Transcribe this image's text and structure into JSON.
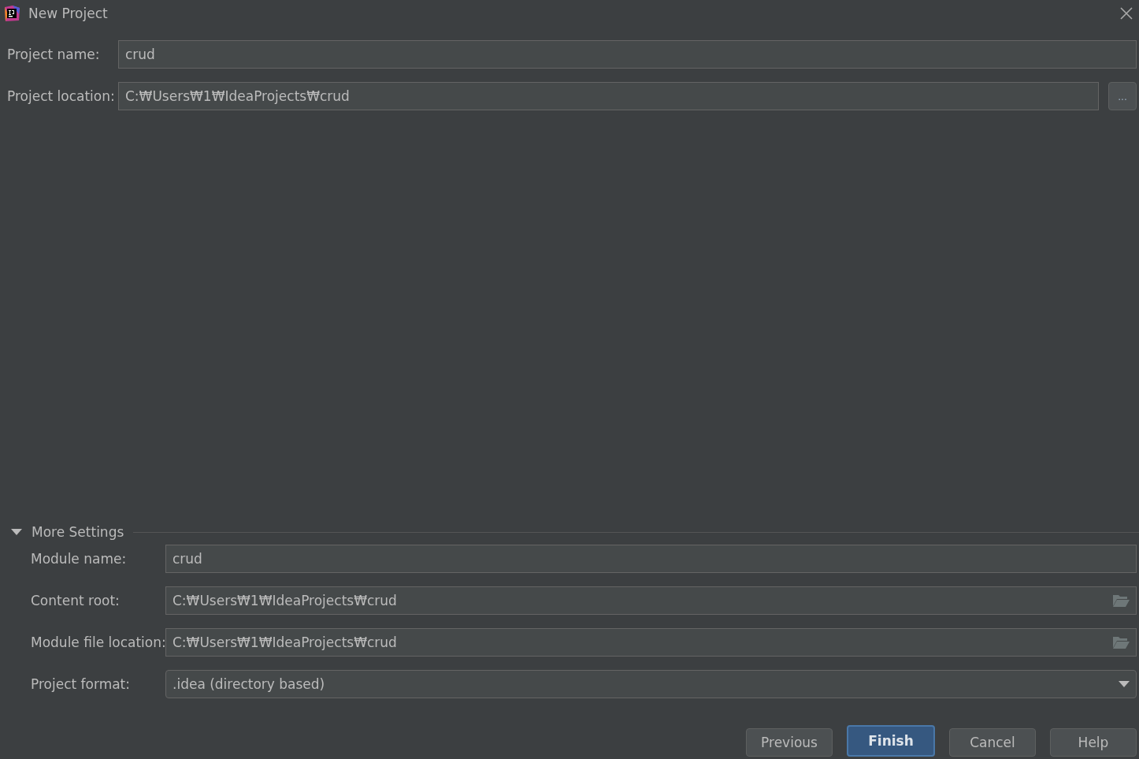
{
  "window": {
    "title": "New Project"
  },
  "top_fields": [
    {
      "label": "Project name:",
      "value": "crud",
      "kind": "text"
    },
    {
      "label": "Project location:",
      "value": "C:₩Users₩1₩IdeaProjects₩crud",
      "kind": "browse",
      "browse_label": "..."
    }
  ],
  "more_settings": {
    "label": "More Settings",
    "expanded": true,
    "fields": [
      {
        "label": "Module name:",
        "value": "crud",
        "kind": "text"
      },
      {
        "label": "Content root:",
        "value": "C:₩Users₩1₩IdeaProjects₩crud",
        "kind": "path"
      },
      {
        "label": "Module file location:",
        "value": "C:₩Users₩1₩IdeaProjects₩crud",
        "kind": "path"
      },
      {
        "label": "Project format:",
        "value": ".idea (directory based)",
        "kind": "select"
      }
    ]
  },
  "buttons": [
    {
      "label": "Previous",
      "default": false
    },
    {
      "label": "Finish",
      "default": true
    },
    {
      "label": "Cancel",
      "default": false
    },
    {
      "label": "Help",
      "default": false
    }
  ]
}
